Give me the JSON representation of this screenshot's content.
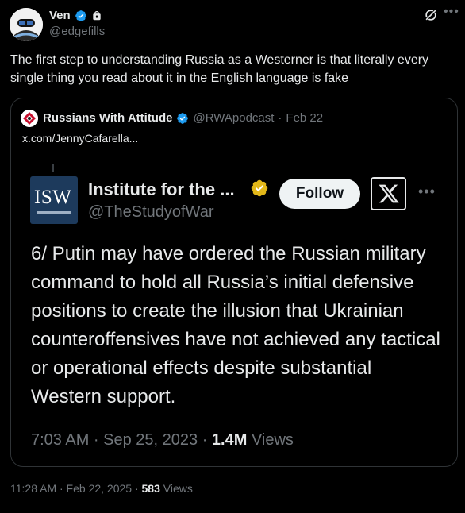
{
  "author": {
    "name": "Ven",
    "handle": "@edgefills"
  },
  "tweet": {
    "text": "The first step to understanding Russia as a Westerner is that literally every single thing you read about it in the English language is fake"
  },
  "quote": {
    "name": "Russians With Attitude",
    "handle": "@RWApodcast",
    "date": "Feb 22",
    "link": "x.com/JennyCafarella..."
  },
  "embed": {
    "logo_text": "ISW",
    "name": "Institute for the ...",
    "handle": "@TheStudyofWar",
    "follow_label": "Follow",
    "text": "6/ Putin may have ordered the Russian military command to hold all Russia’s initial defensive positions to create the illusion that Ukrainian counteroffensives have not achieved any tactical or operational effects despite substantial Western support.",
    "time": "7:03 AM · Sep 25, 2023 · ",
    "views_count": "1.4M",
    "views_label": " Views"
  },
  "footer": {
    "time": "11:28 AM · Feb 22, 2025 · ",
    "views_count": "583",
    "views_label": " Views"
  },
  "colors": {
    "background": "#000000",
    "verified_blue": "#1d9bf0",
    "gold": "#e2b719",
    "muted": "#71767b"
  },
  "icons": [
    "verified-badge-icon",
    "lock-icon",
    "grok-icon",
    "more-icon",
    "x-logo-icon"
  ]
}
